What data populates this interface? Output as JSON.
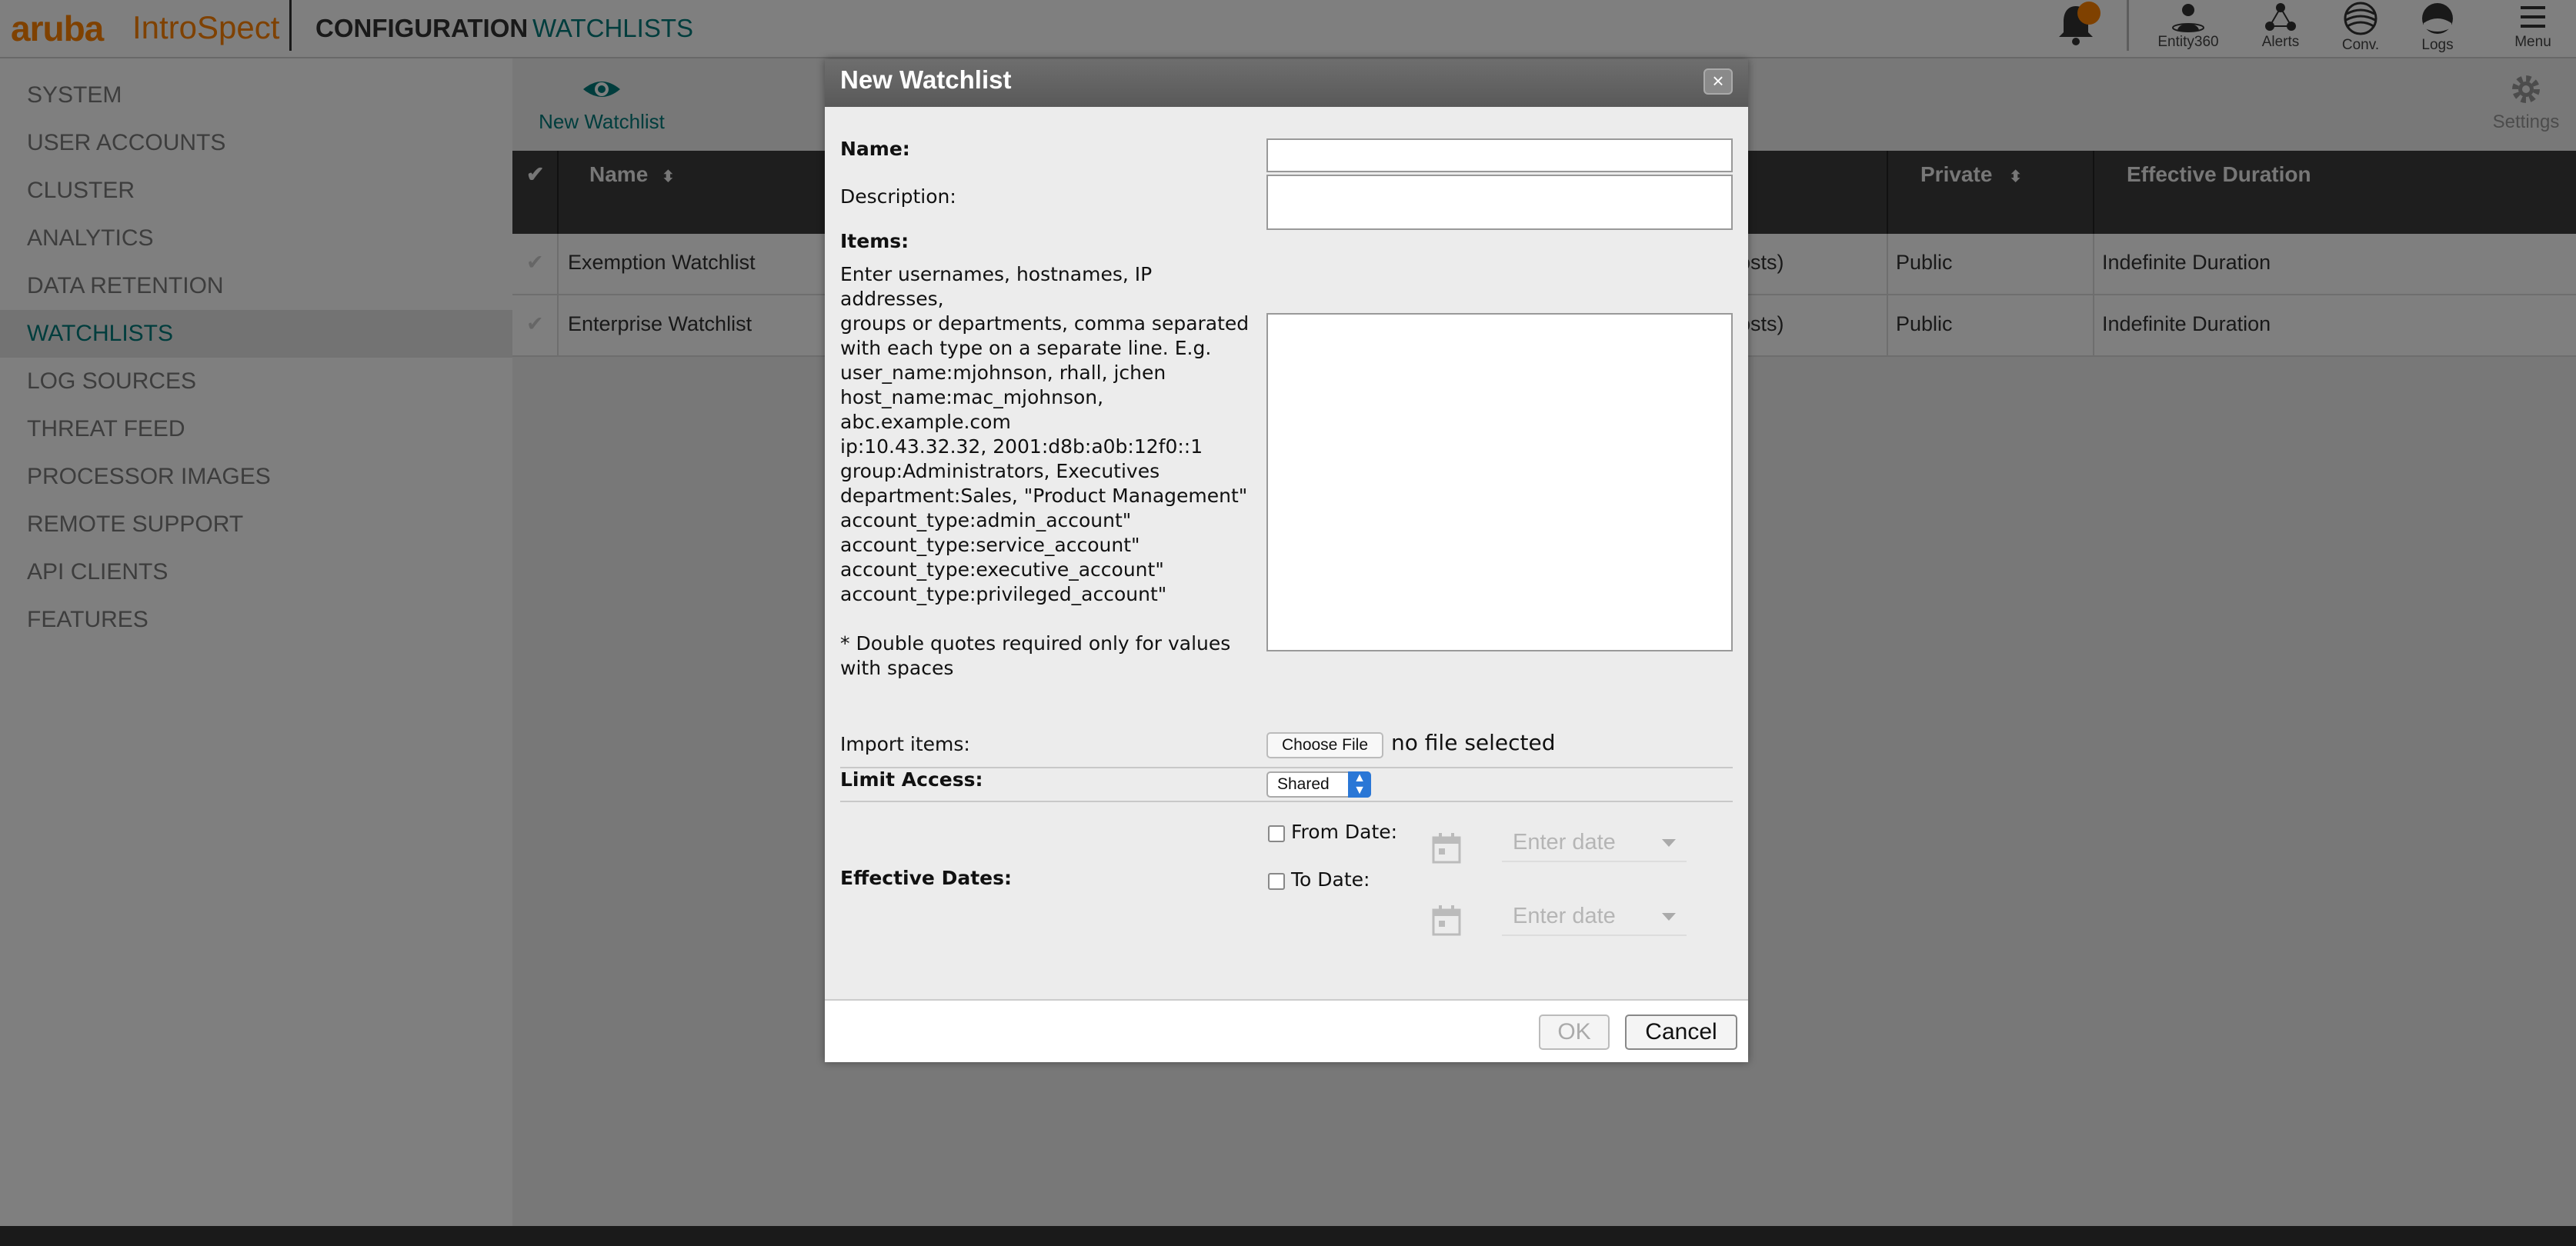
{
  "header": {
    "brand": "aruba",
    "product": "IntroSpect",
    "crumb_primary": "CONFIGURATION",
    "crumb_secondary": "WATCHLISTS",
    "tools": [
      {
        "label": "Entity360",
        "icon": "entity360-icon"
      },
      {
        "label": "Alerts",
        "icon": "alerts-icon"
      },
      {
        "label": "Conv.",
        "icon": "conversations-icon"
      },
      {
        "label": "Logs",
        "icon": "logs-icon"
      },
      {
        "label": "Menu",
        "icon": "hamburger-menu-icon"
      }
    ]
  },
  "sidebar": {
    "items": [
      {
        "label": "SYSTEM"
      },
      {
        "label": "USER ACCOUNTS"
      },
      {
        "label": "CLUSTER"
      },
      {
        "label": "ANALYTICS"
      },
      {
        "label": "DATA RETENTION"
      },
      {
        "label": "WATCHLISTS",
        "active": true
      },
      {
        "label": "LOG SOURCES"
      },
      {
        "label": "THREAT FEED"
      },
      {
        "label": "PROCESSOR IMAGES"
      },
      {
        "label": "REMOTE SUPPORT"
      },
      {
        "label": "API CLIENTS"
      },
      {
        "label": "FEATURES"
      }
    ]
  },
  "main": {
    "new_watchlist": "New Watchlist",
    "settings": "Settings",
    "columns": {
      "name": "Name",
      "private": "Private",
      "duration": "Effective Duration"
    },
    "rows": [
      {
        "name": "Exemption Watchlist",
        "mid": "osts)",
        "private": "Public",
        "duration": "Indefinite Duration"
      },
      {
        "name": "Enterprise Watchlist",
        "mid": "osts)",
        "private": "Public",
        "duration": "Indefinite Duration"
      }
    ]
  },
  "dialog": {
    "title": "New Watchlist",
    "name_label": "Name:",
    "description_label": "Description:",
    "items_label": "Items:",
    "items_help": "Enter usernames, hostnames, IP addresses,\ngroups or departments, comma separated\nwith each type on a separate line. E.g.\n user_name:mjohnson, rhall, jchen\n host_name:mac_mjohnson, abc.example.com\n ip:10.43.32.32, 2001:d8b:a0b:12f0::1\n group:Administrators, Executives\n department:Sales, \"Product Management\"\n account_type:admin_account\"\n account_type:service_account\"\n account_type:executive_account\"\n account_type:privileged_account\"\n\n* Double quotes required only for values with spaces",
    "import_label": "Import items:",
    "choose_file": "Choose File",
    "no_file": "no file selected",
    "limit_access_label": "Limit Access:",
    "limit_access_value": "Shared",
    "effective_dates_label": "Effective Dates:",
    "from_date_label": "From Date:",
    "to_date_label": "To Date:",
    "date_placeholder": "Enter date",
    "ok": "OK",
    "cancel": "Cancel"
  }
}
